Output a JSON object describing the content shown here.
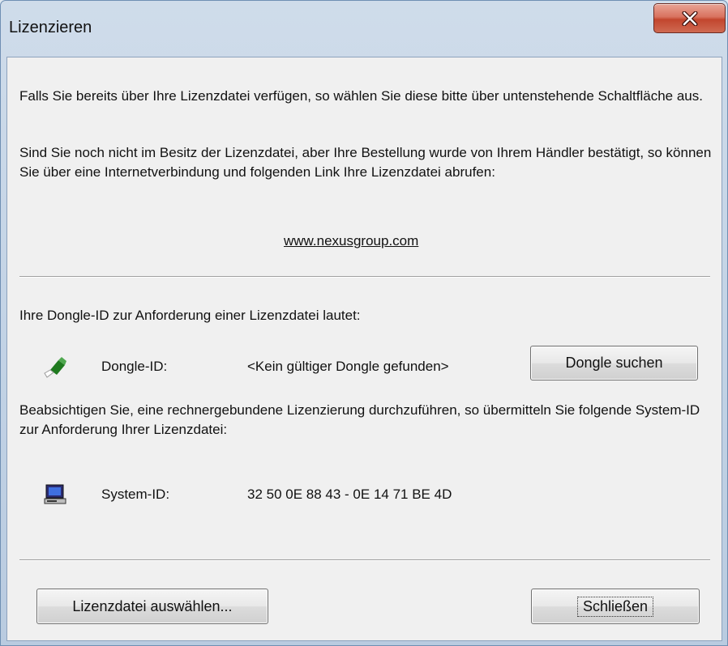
{
  "window": {
    "title": "Lizenzieren",
    "close_icon": "close-icon"
  },
  "intro": {
    "paragraph1": "Falls Sie bereits über Ihre Lizenzdatei verfügen, so wählen Sie diese bitte über untenstehende Schaltfläche aus.",
    "paragraph2": "Sind Sie noch nicht im Besitz der Lizenzdatei, aber Ihre Bestellung wurde von Ihrem Händler bestätigt, so können Sie über eine Internetverbindung und folgenden Link Ihre Lizenzdatei abrufen:",
    "link": "www.nexusgroup.com"
  },
  "dongle": {
    "info": "Ihre Dongle-ID zur Anforderung einer Lizenzdatei lautet:",
    "icon": "dongle-icon",
    "label": "Dongle-ID:",
    "value": "<Kein gültiger Dongle gefunden>",
    "search_button": "Dongle suchen"
  },
  "system": {
    "info": "Beabsichtigen Sie, eine rechnergebundene Lizenzierung durchzuführen, so übermitteln Sie folgende System-ID zur Anforderung Ihrer Lizenzdatei:",
    "icon": "computer-icon",
    "label": "System-ID:",
    "value": "32 50 0E 88 43 - 0E 14 71 BE 4D"
  },
  "footer": {
    "select_button": "Lizenzdatei auswählen...",
    "close_button": "Schließen"
  },
  "colors": {
    "frame": "#c4d4e6",
    "client": "#f0f0f0",
    "close_red": "#c2462e",
    "dongle_green": "#1f7a1f"
  }
}
